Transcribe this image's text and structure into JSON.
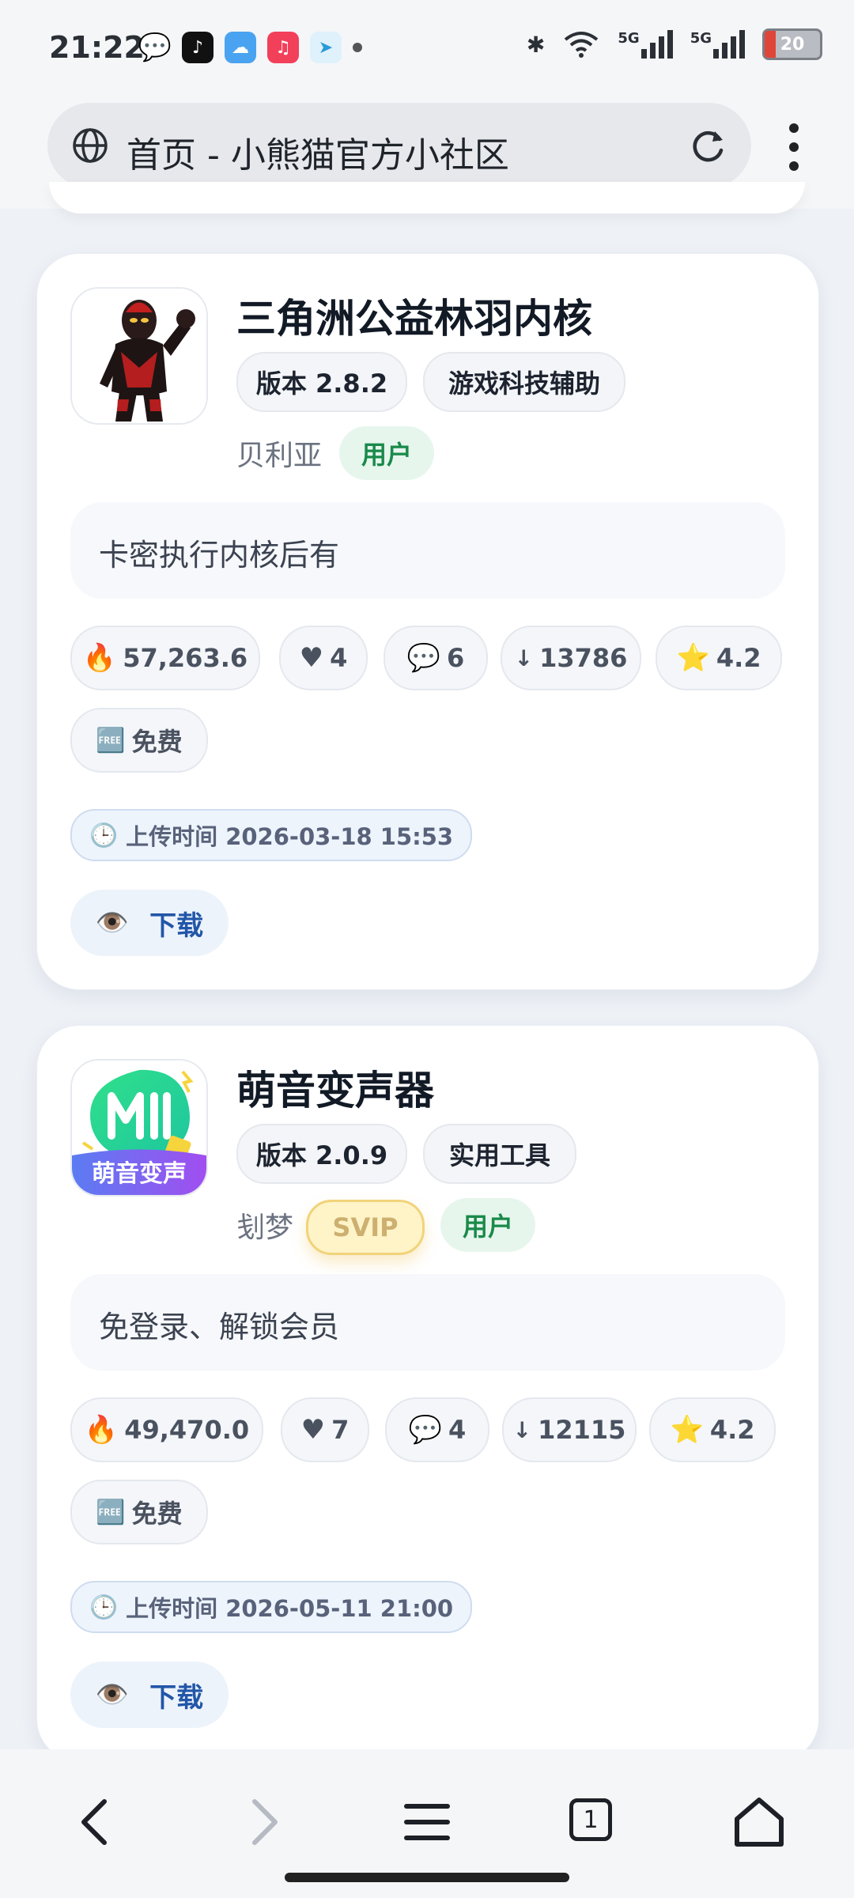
{
  "status_bar": {
    "time": "21:22",
    "network": "5G",
    "network2": "5G",
    "battery": "20"
  },
  "browser": {
    "page_title": "首页 - 小熊猫官方小社区",
    "tab_count": "1"
  },
  "cards": [
    {
      "title": "三角洲公益林羽内核",
      "version": "版本 2.8.2",
      "category": "游戏科技辅助",
      "author": "贝利亚",
      "roles": [
        "用户"
      ],
      "description": "卡密执行内核后有",
      "stats": {
        "heat": "57,263.6",
        "likes": "4",
        "comments": "6",
        "downloads": "13786",
        "rating": "4.2",
        "price": "免费"
      },
      "upload_time": "上传时间 2026-03-18 15:53",
      "download_label": "下载"
    },
    {
      "title": "萌音变声器",
      "version": "版本 2.0.9",
      "category": "实用工具",
      "author": "刬梦",
      "roles": [
        "SVIP",
        "用户"
      ],
      "description": "免登录、解锁会员",
      "icon_text": "萌音变声",
      "stats": {
        "heat": "49,470.0",
        "likes": "7",
        "comments": "4",
        "downloads": "12115",
        "rating": "4.2",
        "price": "免费"
      },
      "upload_time": "上传时间 2026-05-11 21:00",
      "download_label": "下载"
    }
  ]
}
